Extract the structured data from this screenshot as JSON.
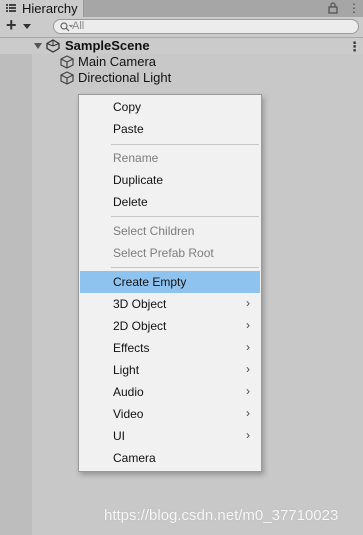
{
  "window": {
    "tab_label": "Hierarchy",
    "lock_icon": "lock-icon",
    "more_icon": "kebab-icon"
  },
  "toolbar": {
    "add_label": "+",
    "search_placeholder": "All"
  },
  "scene": {
    "name": "SampleScene",
    "menu_glyph": "⋮"
  },
  "tree": [
    {
      "label": "Main Camera",
      "icon": "gameobject-cube-icon"
    },
    {
      "label": "Directional Light",
      "icon": "gameobject-cube-icon"
    }
  ],
  "context_menu": {
    "items": [
      {
        "label": "Copy",
        "enabled": true
      },
      {
        "label": "Paste",
        "enabled": true
      },
      {
        "label": "Rename",
        "enabled": false
      },
      {
        "label": "Duplicate",
        "enabled": true
      },
      {
        "label": "Delete",
        "enabled": true
      },
      {
        "label": "Select Children",
        "enabled": false
      },
      {
        "label": "Select Prefab Root",
        "enabled": false
      },
      {
        "label": "Create Empty",
        "enabled": true,
        "highlighted": true
      },
      {
        "label": "3D Object",
        "enabled": true,
        "submenu": true
      },
      {
        "label": "2D Object",
        "enabled": true,
        "submenu": true
      },
      {
        "label": "Effects",
        "enabled": true,
        "submenu": true
      },
      {
        "label": "Light",
        "enabled": true,
        "submenu": true
      },
      {
        "label": "Audio",
        "enabled": true,
        "submenu": true
      },
      {
        "label": "Video",
        "enabled": true,
        "submenu": true
      },
      {
        "label": "UI",
        "enabled": true,
        "submenu": true
      },
      {
        "label": "Camera",
        "enabled": true
      }
    ],
    "submenu_glyph": "›",
    "highlight_color": "#8ec3f0"
  },
  "watermark": "https://blog.csdn.net/m0_37710023"
}
